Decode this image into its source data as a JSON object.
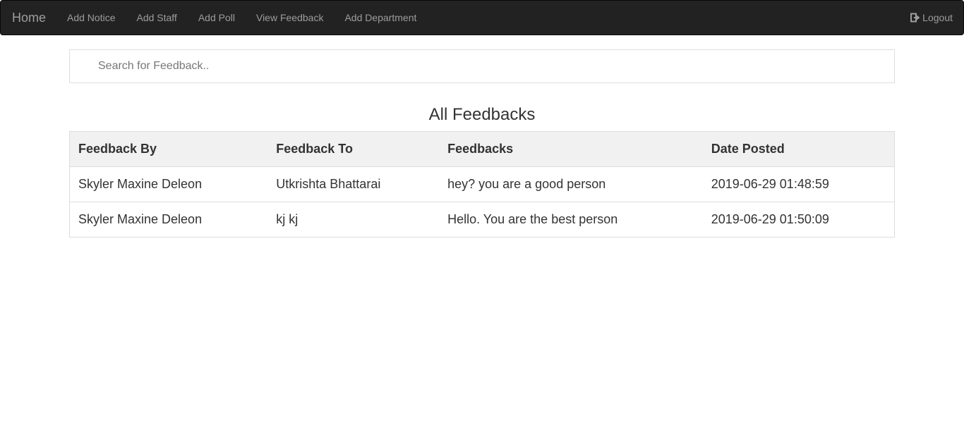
{
  "navbar": {
    "brand": "Home",
    "links": [
      "Add Notice",
      "Add Staff",
      "Add Poll",
      "View Feedback",
      "Add Department"
    ],
    "logout_label": "Logout",
    "logout_icon": "logout-icon"
  },
  "search": {
    "placeholder": "Search for Feedback..",
    "value": ""
  },
  "page": {
    "title": "All Feedbacks"
  },
  "table": {
    "headers": [
      "Feedback By",
      "Feedback To",
      "Feedbacks",
      "Date Posted"
    ],
    "rows": [
      [
        "Skyler Maxine Deleon",
        "Utkrishta Bhattarai",
        "hey? you are a good person",
        "2019-06-29 01:48:59"
      ],
      [
        "Skyler Maxine Deleon",
        "kj kj",
        "Hello. You are the best person",
        "2019-06-29 01:50:09"
      ]
    ]
  },
  "colors": {
    "navbar_bg": "#222222",
    "nav_text": "#9d9d9d",
    "header_bg": "#f1f1f1",
    "border": "#dddddd"
  }
}
